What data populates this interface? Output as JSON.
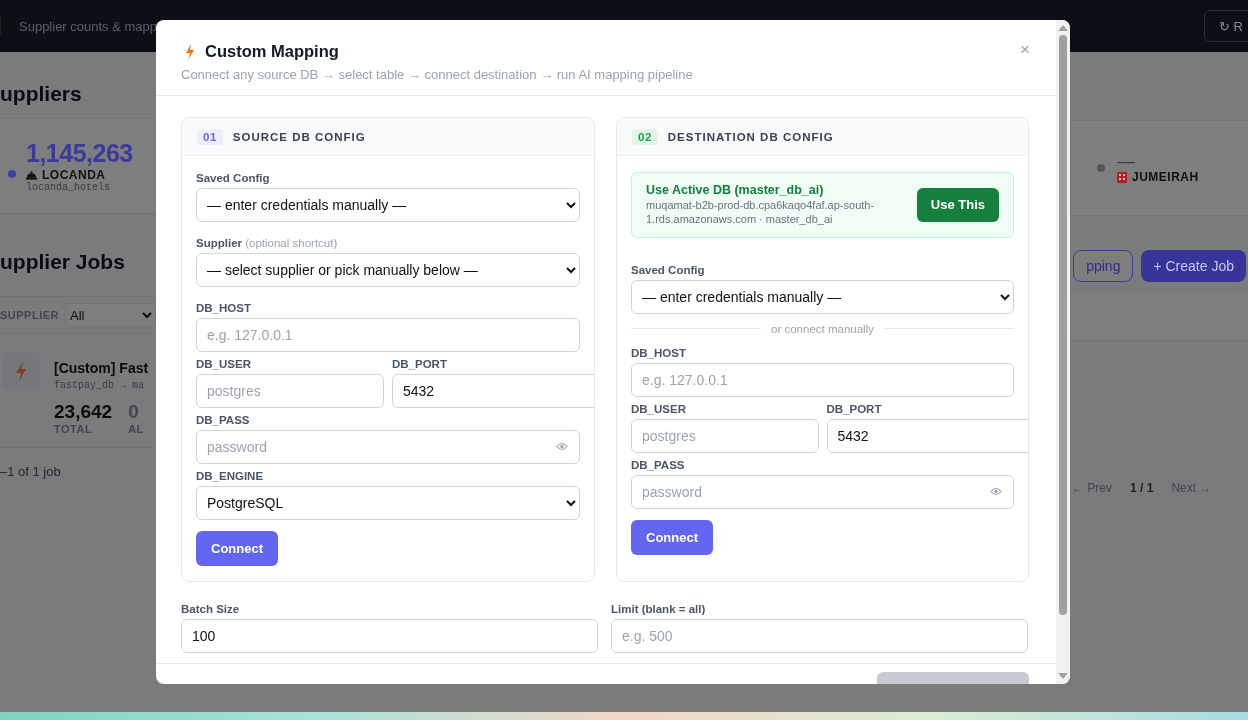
{
  "app": {
    "topbar": {
      "subtitle": "Supplier counts & mapp",
      "refresh_button": "↻ R"
    },
    "heading": "uppliers",
    "stats": [
      {
        "value": "1,145,263",
        "name": "LOCANDA",
        "code": "locanda_hotels",
        "color": "#3f3fa8"
      },
      {
        "value": "—",
        "name": "JUMEIRAH",
        "color": "#555555"
      }
    ],
    "jobs_heading": "upplier Jobs",
    "filter": {
      "label": "SUPPLIER",
      "value": "All"
    },
    "buttons": [
      "pping",
      "+ Create Job"
    ],
    "job": {
      "title": "[Custom] Fast",
      "path": "fastpay_db → ma",
      "total": "23,642",
      "total_label": "TOTAL",
      "second": "0",
      "second_label": "AL"
    },
    "pagination": {
      "summary": "–1 of 1 job",
      "prev": "← Prev",
      "page": "1 / 1",
      "next": "Next →"
    }
  },
  "modal": {
    "title": "Custom Mapping",
    "subtitle": "Connect any source DB → select table → connect destination → run AI mapping pipeline",
    "close": "×",
    "sections": [
      {
        "number": "01",
        "title": "SOURCE DB CONFIG",
        "color": "#6366f1",
        "fields": [
          {
            "kind": "select",
            "label": "Saved Config",
            "value": "— enter credentials manually —"
          },
          {
            "kind": "select",
            "label": "Supplier",
            "hint": "(optional shortcut)",
            "value": "— select supplier or pick manually below —"
          },
          {
            "kind": "input",
            "label": "DB_HOST",
            "placeholder": "e.g. 127.0.0.1"
          },
          {
            "kind": "pair",
            "fields": [
              {
                "label": "DB_USER",
                "placeholder": "postgres"
              },
              {
                "label": "DB_PORT",
                "value": "5432"
              }
            ]
          },
          {
            "kind": "password",
            "label": "DB_PASS",
            "placeholder": "password"
          },
          {
            "kind": "select",
            "label": "DB_ENGINE",
            "value": "PostgreSQL"
          },
          {
            "kind": "button",
            "label": "Connect"
          }
        ]
      },
      {
        "number": "02",
        "title": "DESTINATION DB CONFIG",
        "color": "#16a34a",
        "fields": [
          {
            "kind": "banner",
            "title": "Use Active DB (master_db_ai)",
            "detail": "muqamat-b2b-prod-db.cpa6kaqo4faf.ap-south-1.rds.amazonaws.com · master_db_ai",
            "button": "Use This"
          },
          {
            "kind": "select",
            "label": "Saved Config",
            "value": "— enter credentials manually —"
          },
          {
            "kind": "divider",
            "label": "or connect manually"
          },
          {
            "kind": "input",
            "label": "DB_HOST",
            "placeholder": "e.g. 127.0.0.1"
          },
          {
            "kind": "pair",
            "fields": [
              {
                "label": "DB_USER",
                "placeholder": "postgres"
              },
              {
                "label": "DB_PORT",
                "value": "5432"
              }
            ]
          },
          {
            "kind": "password",
            "label": "DB_PASS",
            "placeholder": "password"
          },
          {
            "kind": "button",
            "label": "Connect"
          }
        ]
      }
    ],
    "options": [
      {
        "label": "Batch Size",
        "value": "100"
      },
      {
        "label": "Limit (blank = all)",
        "placeholder": "e.g. 500"
      }
    ]
  }
}
